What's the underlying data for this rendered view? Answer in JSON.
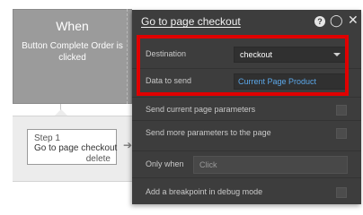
{
  "trigger": {
    "title": "When",
    "description": "Button Complete Order is clicked"
  },
  "step": {
    "number_label": "Step 1",
    "name": "Go to page checkout",
    "delete_label": "delete"
  },
  "panel": {
    "title": "Go to page checkout",
    "help_glyph": "?",
    "comment_glyph": "◯",
    "close_glyph": "✕",
    "destination": {
      "label": "Destination",
      "value": "checkout"
    },
    "data_to_send": {
      "label": "Data to send",
      "value": "Current Page Product"
    },
    "send_current_params": {
      "label": "Send current page parameters"
    },
    "send_more_params": {
      "label": "Send more parameters to the page"
    },
    "only_when": {
      "label": "Only when",
      "placeholder": "Click"
    },
    "breakpoint": {
      "label": "Add a breakpoint in debug mode"
    }
  },
  "colors": {
    "highlight_border": "#e00000",
    "panel_bg": "#3d3d3d",
    "link_value": "#5ba7e8",
    "trigger_bg": "#9b9b9b"
  }
}
